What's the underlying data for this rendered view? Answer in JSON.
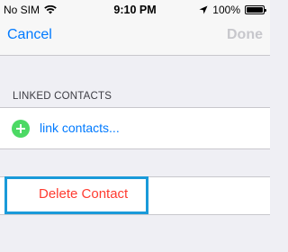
{
  "status_bar": {
    "carrier": "No SIM",
    "time": "9:10 PM",
    "battery_percent": "100%",
    "battery_level": 1.0,
    "icons": [
      "wifi-icon",
      "location-arrow-icon",
      "battery-icon"
    ]
  },
  "nav": {
    "cancel_label": "Cancel",
    "done_label": "Done"
  },
  "linked_contacts": {
    "header": "LINKED CONTACTS",
    "add_label": "link contacts..."
  },
  "actions": {
    "delete_label": "Delete Contact"
  },
  "colors": {
    "accent": "#007aff",
    "add_green": "#4cd964",
    "destructive": "#ff3b30",
    "highlight": "#1a9ad9",
    "background": "#efeff4"
  }
}
